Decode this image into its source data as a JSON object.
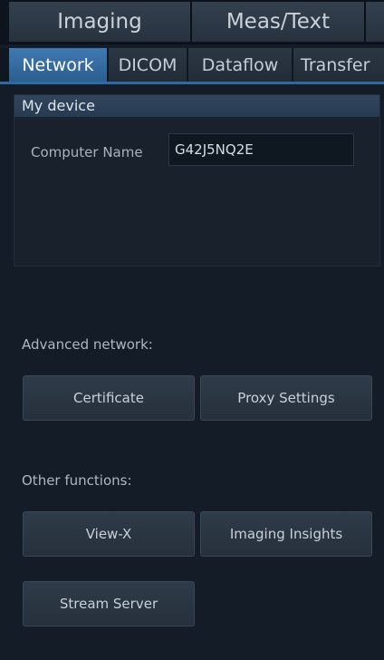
{
  "top_tabs": [
    {
      "label": "Imaging"
    },
    {
      "label": "Meas/Text"
    },
    {
      "label": ""
    }
  ],
  "sub_tabs": [
    {
      "label": "Network",
      "active": true
    },
    {
      "label": "DICOM",
      "active": false
    },
    {
      "label": "Dataflow",
      "active": false
    },
    {
      "label": "Transfer",
      "active": false
    }
  ],
  "my_device": {
    "title": "My device",
    "computer_name_label": "Computer Name",
    "computer_name_value": "G42J5NQ2E"
  },
  "advanced_network": {
    "label": "Advanced network:",
    "buttons": [
      "Certificate",
      "Proxy Settings"
    ]
  },
  "other_functions": {
    "label": "Other functions:",
    "buttons": [
      "View-X",
      "Imaging Insights",
      "Stream Server"
    ]
  },
  "colors": {
    "active_tab": "#2f6aa0",
    "background": "#141c27"
  }
}
